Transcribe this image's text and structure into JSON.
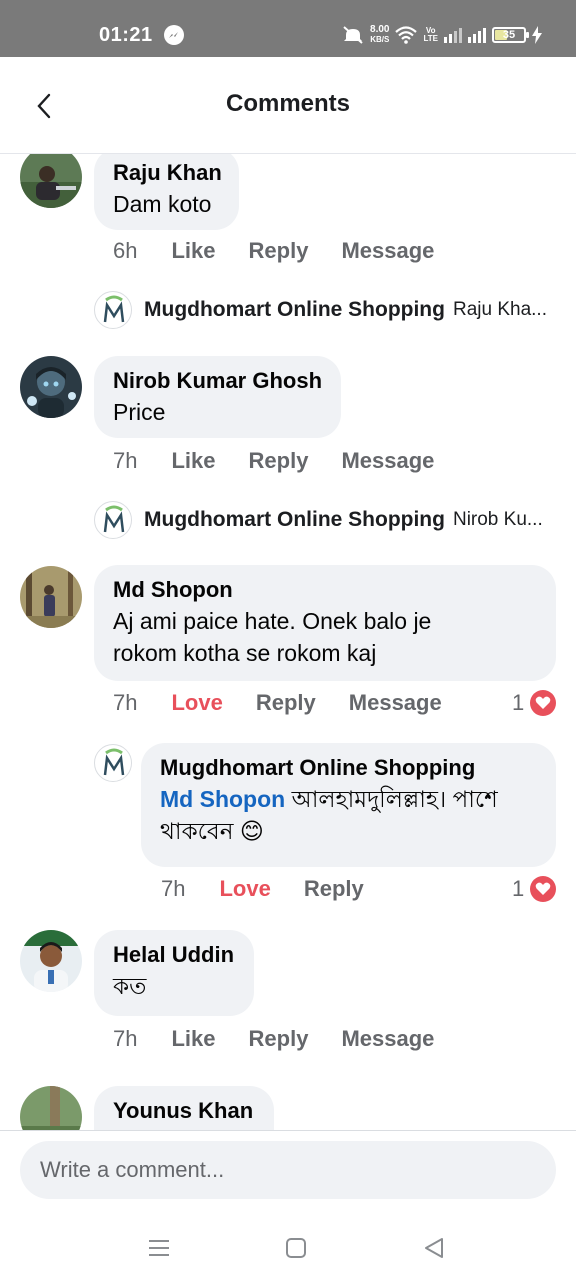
{
  "status_bar": {
    "time": "01:21",
    "speed_value": "8.00",
    "speed_unit": "KB/S",
    "network_top": "Vo",
    "network_bottom": "LTE",
    "battery": "35"
  },
  "header": {
    "title": "Comments"
  },
  "comments": [
    {
      "author": "Raju Khan",
      "text": "Dam koto",
      "time": "6h",
      "like": "Like",
      "reply": "Reply",
      "message": "Message",
      "page_reply": {
        "name": "Mugdhomart Online Shopping",
        "snippet": "Raju Kha..."
      }
    },
    {
      "author": "Nirob Kumar Ghosh",
      "text": "Price",
      "time": "7h",
      "like": "Like",
      "reply": "Reply",
      "message": "Message",
      "page_reply": {
        "name": "Mugdhomart Online Shopping",
        "snippet": "Nirob Ku..."
      }
    },
    {
      "author": "Md Shopon",
      "text_line1": "Aj ami paice hate. Onek balo je",
      "text_line2": "rokom kotha se rokom kaj",
      "time": "7h",
      "like": "Love",
      "reply": "Reply",
      "message": "Message",
      "reaction_count": "1",
      "reply_expanded": {
        "author": "Mugdhomart Online Shopping",
        "mention": "Md Shopon",
        "text_line1": "আলহামদুলিল্লাহ। পাশে",
        "text_line2": "থাকবেন",
        "emoji": "😊",
        "time": "7h",
        "like": "Love",
        "reply": "Reply",
        "reaction_count": "1"
      }
    },
    {
      "author": "Helal Uddin",
      "text": "কত",
      "time": "7h",
      "like": "Like",
      "reply": "Reply",
      "message": "Message"
    },
    {
      "author": "Younus Khan"
    }
  ],
  "composer": {
    "placeholder": "Write a comment..."
  },
  "colors": {
    "love": "#e8505b",
    "mention": "#1565c0",
    "bubble": "#f0f2f5",
    "secondary_text": "#65676b"
  }
}
